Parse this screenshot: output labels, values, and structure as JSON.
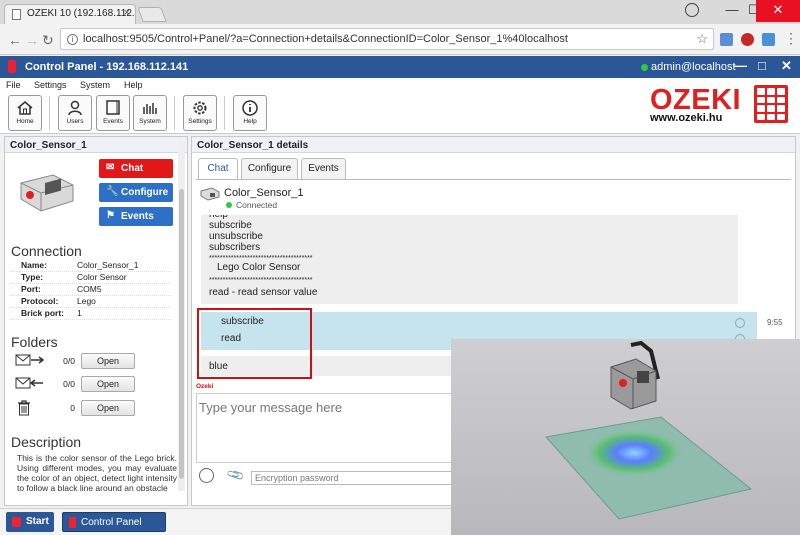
{
  "browser": {
    "tab_title": "OZEKI 10 (192.168.112.14",
    "url": "localhost:9505/Control+Panel/?a=Connection+details&ConnectionID=Color_Sensor_1%40localhost",
    "window_controls": {
      "minimize": "—",
      "maximize": "☐",
      "close": "✕"
    }
  },
  "app": {
    "title": "Control Panel - 192.168.112.141",
    "user": "admin@localhost",
    "menu": [
      "File",
      "Settings",
      "System",
      "Help"
    ],
    "toolbar": [
      {
        "label": "Home",
        "icon": "home-icon"
      },
      {
        "label": "Users",
        "icon": "users-icon"
      },
      {
        "label": "Events",
        "icon": "events-icon"
      },
      {
        "label": "System",
        "icon": "system-icon"
      },
      {
        "label": "Settings",
        "icon": "settings-icon"
      },
      {
        "label": "Help",
        "icon": "help-icon"
      }
    ],
    "logo": {
      "word": "OZEKI",
      "url": "www.ozeki.hu"
    }
  },
  "left": {
    "header": "Color_Sensor_1",
    "actions": [
      {
        "label": "Chat",
        "color": "#e21818",
        "icon": "chat-icon"
      },
      {
        "label": "Configure",
        "color": "#2e6fc7",
        "icon": "wrench-icon"
      },
      {
        "label": "Events",
        "color": "#2e6fc7",
        "icon": "flag-icon"
      }
    ],
    "connection_title": "Connection",
    "connection": [
      {
        "k": "Name:",
        "v": "Color_Sensor_1"
      },
      {
        "k": "Type:",
        "v": "Color Sensor"
      },
      {
        "k": "Port:",
        "v": "COM5"
      },
      {
        "k": "Protocol:",
        "v": "Lego"
      },
      {
        "k": "Brick port:",
        "v": "1"
      }
    ],
    "folders_title": "Folders",
    "folders": [
      {
        "count": "0/0",
        "button": "Open",
        "icon": "outbox-icon"
      },
      {
        "count": "0/0",
        "button": "Open",
        "icon": "inbox-icon"
      },
      {
        "count": "0",
        "button": "Open",
        "icon": "trash-icon"
      }
    ],
    "description_title": "Description",
    "description": "This is the color sensor of the Lego brick. Using different modes, you may evaluate the color of an object, detect light intensity to follow a black line around an obstacle"
  },
  "right": {
    "header": "Color_Sensor_1 details",
    "tabs": [
      "Chat",
      "Configure",
      "Events"
    ],
    "device_name": "Color_Sensor_1",
    "device_status": "Connected",
    "incoming_lines": [
      "help",
      "subscribe",
      "unsubscribe",
      "subscribers",
      "**************************************",
      "   Lego Color Sensor",
      "**************************************",
      "read - read sensor value"
    ],
    "outgoing_lines": [
      "subscribe",
      "read"
    ],
    "outgoing_time": "9:55",
    "reply": "blue",
    "composer_brand": "Ozeki",
    "composer_placeholder": "Type your message here",
    "encryption_placeholder": "Encryption password"
  },
  "taskbar": {
    "start": "Start",
    "item": "Control Panel"
  }
}
